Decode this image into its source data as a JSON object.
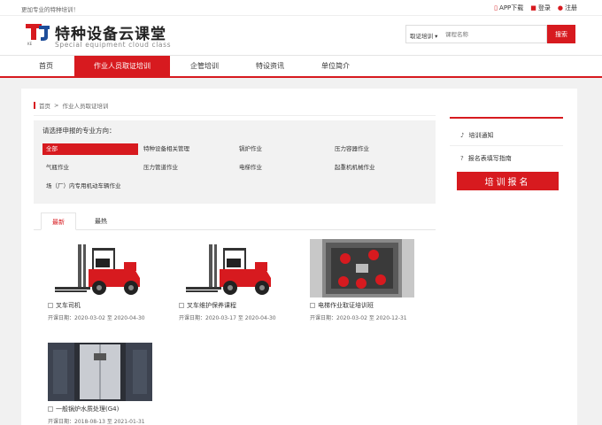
{
  "topbar": {
    "tagline": "更加专业的特种培训！",
    "links": [
      {
        "icon": "phone-icon",
        "glyph": "▯",
        "label": "APP下载"
      },
      {
        "icon": "lock-icon",
        "glyph": "■",
        "label": "登录"
      },
      {
        "icon": "user-icon",
        "glyph": "●",
        "label": "注册"
      }
    ]
  },
  "header": {
    "logo_text": "特种设备云课堂",
    "logo_sub": "Special equipment cloud class",
    "logo_mark_letters": "TJ",
    "logo_mark_small": "KE",
    "search": {
      "category": "取证培训",
      "category_arrow": "▾",
      "placeholder": "课程名称",
      "button": "搜索"
    }
  },
  "nav": {
    "tabs": [
      {
        "label": "首页",
        "active": false
      },
      {
        "label": "作业人员取证培训",
        "active": true
      },
      {
        "label": "企管培训",
        "active": false
      },
      {
        "label": "特设资讯",
        "active": false
      },
      {
        "label": "单位简介",
        "active": false
      }
    ]
  },
  "breadcrumb": {
    "home": "首页",
    "separator": ">",
    "current": "作业人员取证培训"
  },
  "filter": {
    "title": "请选择申报的专业方向：",
    "options": [
      {
        "label": "全部",
        "active": true
      },
      {
        "label": "特种设备相关管理",
        "active": false
      },
      {
        "label": "锅炉作业",
        "active": false
      },
      {
        "label": "压力容器作业",
        "active": false
      },
      {
        "label": "气瓶作业",
        "active": false
      },
      {
        "label": "压力管道作业",
        "active": false
      },
      {
        "label": "电梯作业",
        "active": false
      },
      {
        "label": "起重机机械作业",
        "active": false
      },
      {
        "label": "场（厂）内专用机动车辆作业",
        "active": false
      }
    ]
  },
  "sort_tabs": [
    {
      "label": "最新",
      "active": true
    },
    {
      "label": "最热",
      "active": false
    }
  ],
  "courses": [
    {
      "title": "叉车司机",
      "date_label": "开课日期：",
      "start": "2020-03-02",
      "to": "至",
      "end": "2020-04-30",
      "image": "forklift"
    },
    {
      "title": "叉车维护保养课程",
      "date_label": "开课日期：",
      "start": "2020-03-17",
      "to": "至",
      "end": "2020-04-30",
      "image": "forklift"
    },
    {
      "title": "电梯作业取证培训班",
      "date_label": "开课日期：",
      "start": "2020-03-02",
      "to": "至",
      "end": "2020-12-31",
      "image": "elevator-shaft"
    },
    {
      "title": "一般锅炉水质处理(G4)",
      "date_label": "开课日期：",
      "start": "2018-08-13",
      "to": "至",
      "end": "2021-01-31",
      "image": "elevator-door"
    }
  ],
  "sidebar": {
    "items": [
      {
        "icon": "bell-icon",
        "glyph": "♪",
        "label": "培训通知"
      },
      {
        "icon": "help-icon",
        "glyph": "?",
        "label": "报名表填写指南"
      }
    ],
    "apply_button": "培训报名"
  },
  "colors": {
    "brand_red": "#d71a1f",
    "brand_blue": "#1f4e9a"
  }
}
